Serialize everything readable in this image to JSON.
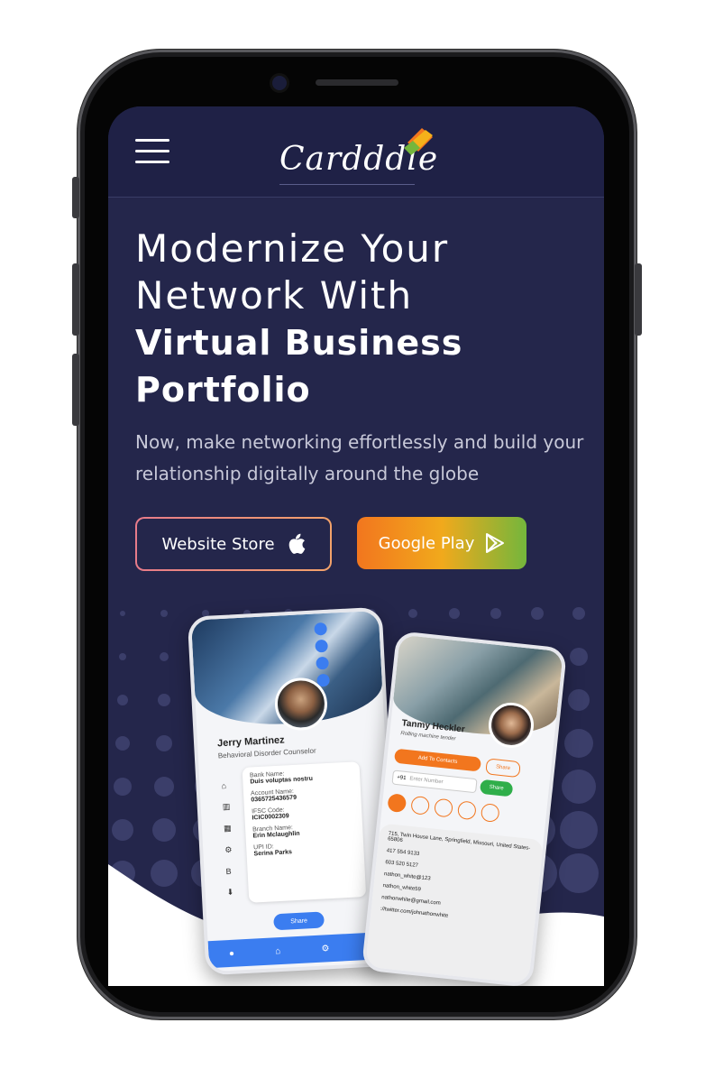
{
  "brand": {
    "logo_text": "Cardddle"
  },
  "hero": {
    "line1": "Modernize Your",
    "line2": "Network With",
    "line3": "Virtual Business",
    "line4": "Portfolio",
    "subtitle": "Now, make networking effortlessly and build your relationship digitally around the globe"
  },
  "buttons": {
    "store_label": "Website Store",
    "play_label": "Google Play"
  },
  "mockup_left": {
    "name": "Jerry Martinez",
    "title": "Behavioral Disorder Counselor",
    "fields": [
      {
        "label": "Bank Name:",
        "value": "Duis voluptas nostru"
      },
      {
        "label": "Account Name:",
        "value": "0365725436579"
      },
      {
        "label": "IFSC Code:",
        "value": "ICIC0002309"
      },
      {
        "label": "Branch Name:",
        "value": "Erin Mclaughlin"
      },
      {
        "label": "UPI ID:",
        "value": "Serina Parks"
      }
    ],
    "share_label": "Share"
  },
  "mockup_right": {
    "name": "Tanmy Heckler",
    "title": "Rolling machine tender",
    "add_label": "Add To Contacts",
    "share_label": "Share",
    "phone_code": "+91",
    "phone_placeholder": "Enter Number",
    "share2_label": "Share",
    "details": [
      "715, Twin House Lane, Springfield, Missouri, United States-65806",
      "417 554 9133",
      "603 520 5127",
      "nathon_white@123",
      "nathon_white59",
      "nathonwhite@gmail.com",
      "://twitter.com/johnathonwhite"
    ]
  },
  "colors": {
    "background": "#24264b",
    "accent_orange": "#f2761e",
    "accent_green": "#74b63c",
    "accent_blue": "#3b7df0"
  }
}
